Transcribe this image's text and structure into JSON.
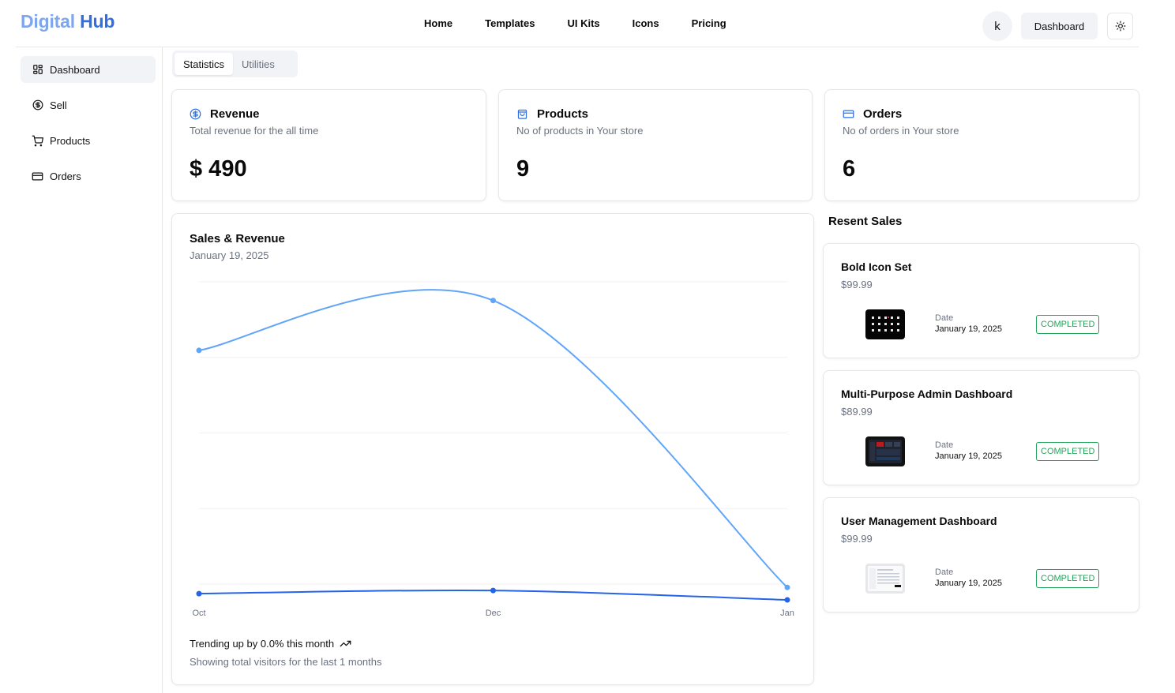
{
  "brand": {
    "part1": "Digital",
    "part2": "Hub"
  },
  "nav": [
    "Home",
    "Templates",
    "UI Kits",
    "Icons",
    "Pricing"
  ],
  "header": {
    "avatar_initial": "k",
    "dashboard_button": "Dashboard"
  },
  "sidebar": {
    "items": [
      {
        "label": "Dashboard",
        "icon": "dashboard-grid-icon",
        "active": true
      },
      {
        "label": "Sell",
        "icon": "dollar-circle-icon",
        "active": false
      },
      {
        "label": "Products",
        "icon": "cart-icon",
        "active": false
      },
      {
        "label": "Orders",
        "icon": "credit-card-icon",
        "active": false
      }
    ]
  },
  "tabs": [
    {
      "label": "Statistics",
      "active": true
    },
    {
      "label": "Utilities",
      "active": false
    }
  ],
  "stats": [
    {
      "title": "Revenue",
      "description": "Total revenue for the all time",
      "value": "$ 490",
      "icon": "dollar-circle-icon"
    },
    {
      "title": "Products",
      "description": "No of products in Your store",
      "value": "9",
      "icon": "shopping-bag-icon"
    },
    {
      "title": "Orders",
      "description": "No of orders in Your store",
      "value": "6",
      "icon": "credit-card-icon"
    }
  ],
  "chart": {
    "title": "Sales & Revenue",
    "subtitle": "January 19, 2025",
    "trend_text": "Trending up by 0.0% this month",
    "footer_text": "Showing total visitors for the last 1 months"
  },
  "chart_data": {
    "type": "line",
    "x": [
      "Oct",
      "Dec",
      "Jan"
    ],
    "series": [
      {
        "values": [
          390,
          470,
          10
        ],
        "color": "#60a5fa"
      },
      {
        "values": [
          0,
          5,
          -10
        ],
        "color": "#2563eb"
      }
    ],
    "ylim": [
      -10,
      500
    ],
    "grid": true,
    "curve": "smooth"
  },
  "recent_sales": {
    "title": "Resent Sales",
    "date_label": "Date",
    "items": [
      {
        "name": "Bold Icon Set",
        "price": "$99.99",
        "date": "January 19, 2025",
        "status": "COMPLETED",
        "thumb": "dark-icons"
      },
      {
        "name": "Multi-Purpose Admin Dashboard",
        "price": "$89.99",
        "date": "January 19, 2025",
        "status": "COMPLETED",
        "thumb": "dark-dashboard"
      },
      {
        "name": "User Management Dashboard",
        "price": "$99.99",
        "date": "January 19, 2025",
        "status": "COMPLETED",
        "thumb": "light-dashboard"
      }
    ]
  },
  "colors": {
    "accent": "#2f6fe0",
    "success": "#22a35a",
    "muted": "#6b7280"
  }
}
